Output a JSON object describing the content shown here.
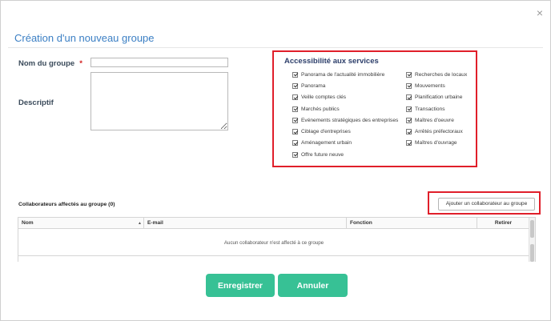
{
  "modal": {
    "title": "Création d'un nouveau groupe",
    "close_glyph": "×"
  },
  "form": {
    "name_label": "Nom du groupe",
    "required_mark": "*",
    "name_value": "",
    "description_label": "Descriptif",
    "description_value": ""
  },
  "services": {
    "title": "Accessibilité aux services",
    "left": [
      {
        "label": "Panorama de l'actualité immobilière",
        "checked": true
      },
      {
        "label": "Panorama",
        "checked": true
      },
      {
        "label": "Veille comptes clés",
        "checked": true
      },
      {
        "label": "Marchés publics",
        "checked": true
      },
      {
        "label": "Evénements stratégiques des entreprises",
        "checked": true
      },
      {
        "label": "Ciblage d'entreprises",
        "checked": true
      },
      {
        "label": "Aménagement urbain",
        "checked": true
      },
      {
        "label": "Offre future neuve",
        "checked": true
      }
    ],
    "right": [
      {
        "label": "Recherches de locaux",
        "checked": true
      },
      {
        "label": "Mouvements",
        "checked": true
      },
      {
        "label": "Planification urbaine",
        "checked": true
      },
      {
        "label": "Transactions",
        "checked": true
      },
      {
        "label": "Maîtres d'oeuvre",
        "checked": true
      },
      {
        "label": "Arrêtés préfectoraux",
        "checked": true
      },
      {
        "label": "Maîtres d'ouvrage",
        "checked": true
      }
    ]
  },
  "collaborators": {
    "title": "Collaborateurs affectés au groupe (0)",
    "add_button": "Ajouter un collaborateur au groupe",
    "columns": {
      "name": "Nom",
      "email": "E-mail",
      "function": "Fonction",
      "remove": "Retirer"
    },
    "sort_glyph": "▲",
    "empty_message": "Aucun collaborateur n'est affecté à ce groupe"
  },
  "actions": {
    "save": "Enregistrer",
    "cancel": "Annuler"
  },
  "colors": {
    "accent_green": "#37c195",
    "title_blue": "#3b7fc4",
    "highlight_red": "#e01f2a"
  }
}
